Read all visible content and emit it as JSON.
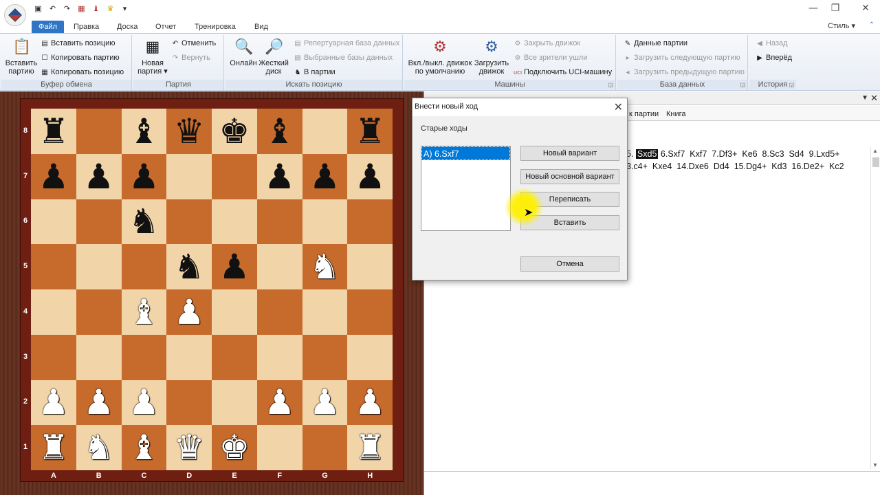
{
  "window": {
    "qat_icons": [
      "save-icon",
      "undo-icon",
      "redo-icon",
      "board-icon",
      "piece-icon",
      "trophy-icon",
      "dropdown-icon"
    ],
    "controls": {
      "minimize": "—",
      "maximize": "❐",
      "close": "✕"
    }
  },
  "tabs": [
    "Файл",
    "Правка",
    "Доска",
    "Отчет",
    "Тренировка",
    "Вид"
  ],
  "active_tab": "Файл",
  "style_menu": "Стиль ▾",
  "ribbon": {
    "clipboard": {
      "paste_game": "Вставить\nпартию",
      "paste_position": "Вставить позицию",
      "copy_game": "Копировать партию",
      "copy_position": "Копировать позицию",
      "label": "Буфер обмена"
    },
    "game": {
      "new_game": "Новая\nпартия ▾",
      "undo": "Отменить",
      "redo": "Вернуть",
      "label": "Партия"
    },
    "search": {
      "online": "Онлайн",
      "hard_disk": "Жесткий\nдиск",
      "rep_db": "Репертуарная база данных",
      "selected_db": "Выбранные базы данных",
      "in_game": "В партии",
      "label": "Искать позицию"
    },
    "engines": {
      "toggle_engine": "Вкл./выкл. движок\nпо умолчанию",
      "load_engine": "Загрузить\nдвижок",
      "close_engine": "Закрыть движок",
      "all_spectators": "Все зрители ушли",
      "uci": "Подключить UCI-машину",
      "label": "Машины"
    },
    "database": {
      "game_data": "Данные партии",
      "load_next": "Загрузить следующую партию",
      "load_prev": "Загрузить предыдущую партию",
      "label": "База данных"
    },
    "history": {
      "back": "Назад",
      "forward": "Вперёд",
      "label": "История"
    }
  },
  "board": {
    "ranks": [
      "8",
      "7",
      "6",
      "5",
      "4",
      "3",
      "2",
      "1"
    ],
    "files": [
      "A",
      "B",
      "C",
      "D",
      "E",
      "F",
      "G",
      "H"
    ],
    "position": [
      [
        "br",
        "",
        "bb",
        "bq",
        "bk",
        "bb",
        "",
        "br"
      ],
      [
        "bp",
        "bp",
        "bp",
        "",
        "",
        "bp",
        "bp",
        "bp"
      ],
      [
        "",
        "",
        "bn",
        "",
        "",
        "",
        "",
        ""
      ],
      [
        "",
        "",
        "",
        "bn",
        "bp",
        "",
        "wn",
        ""
      ],
      [
        "",
        "",
        "wb",
        "wp",
        "",
        "",
        "",
        ""
      ],
      [
        "",
        "",
        "",
        "",
        "",
        "",
        "",
        ""
      ],
      [
        "wp",
        "wp",
        "wp",
        "",
        "",
        "wp",
        "wp",
        "wp"
      ],
      [
        "wr",
        "wn",
        "wb",
        "wq",
        "wk",
        "",
        "",
        "wr"
      ]
    ]
  },
  "panel": {
    "tabs": [
      "к партии",
      "Книга"
    ],
    "notation_line1_pre": "5.",
    "notation_highlight": "Sxd5",
    "notation_line1_post": "6.Sxf7  Kxf7  7.Df3+  Ke6  8.Sc3  Sd4  9.Lxd5+",
    "notation_line2": "3.c4+  Kxe4  14.Dxe6  Dd4  15.Dg4+  Kd3  16.De2+  Kc2"
  },
  "dialog": {
    "title": "Внести новый ход",
    "old_moves_label": "Старые ходы",
    "old_moves": [
      "A) 6.Sxf7"
    ],
    "btn_new_variation": "Новый вариант",
    "btn_new_main": "Новый основной вариант",
    "btn_overwrite": "Переписать",
    "btn_insert": "Вставить",
    "btn_cancel": "Отмена",
    "close": "✕"
  }
}
